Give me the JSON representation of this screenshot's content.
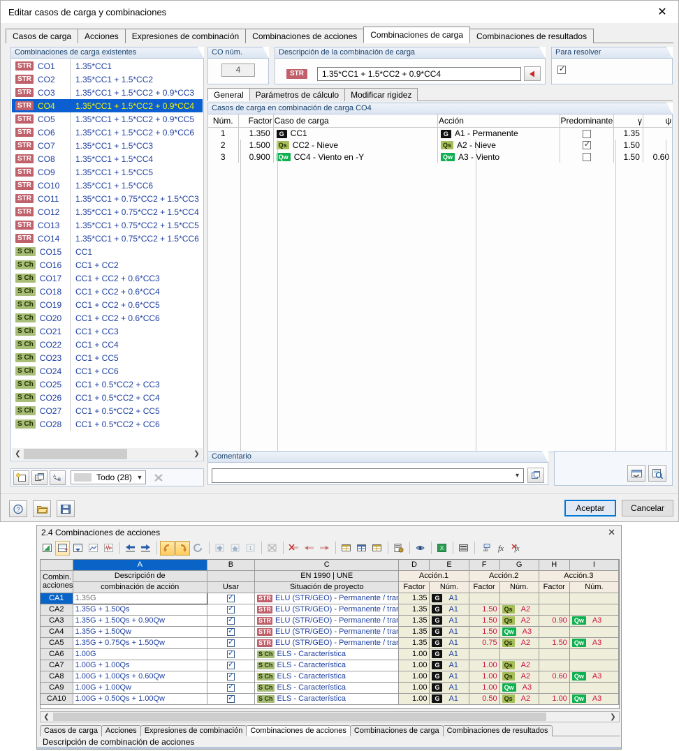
{
  "dialog": {
    "title": "Editar casos de carga y combinaciones",
    "close_icon": "close-icon",
    "tabs": [
      {
        "label": "Casos de carga",
        "active": false
      },
      {
        "label": "Acciones",
        "active": false
      },
      {
        "label": "Expresiones de combinación",
        "active": false
      },
      {
        "label": "Combinaciones de acciones",
        "active": false
      },
      {
        "label": "Combinaciones de carga",
        "active": true
      },
      {
        "label": "Combinaciones de resultados",
        "active": false
      }
    ]
  },
  "list_panel": {
    "header": "Combinaciones de carga existentes",
    "rows": [
      {
        "tag": "STR",
        "num": "CO1",
        "desc": "1.35*CC1",
        "selected": false
      },
      {
        "tag": "STR",
        "num": "CO2",
        "desc": "1.35*CC1 + 1.5*CC2",
        "selected": false
      },
      {
        "tag": "STR",
        "num": "CO3",
        "desc": "1.35*CC1 + 1.5*CC2 + 0.9*CC3",
        "selected": false
      },
      {
        "tag": "STR",
        "num": "CO4",
        "desc": "1.35*CC1 + 1.5*CC2 + 0.9*CC4",
        "selected": true
      },
      {
        "tag": "STR",
        "num": "CO5",
        "desc": "1.35*CC1 + 1.5*CC2 + 0.9*CC5",
        "selected": false
      },
      {
        "tag": "STR",
        "num": "CO6",
        "desc": "1.35*CC1 + 1.5*CC2 + 0.9*CC6",
        "selected": false
      },
      {
        "tag": "STR",
        "num": "CO7",
        "desc": "1.35*CC1 + 1.5*CC3",
        "selected": false
      },
      {
        "tag": "STR",
        "num": "CO8",
        "desc": "1.35*CC1 + 1.5*CC4",
        "selected": false
      },
      {
        "tag": "STR",
        "num": "CO9",
        "desc": "1.35*CC1 + 1.5*CC5",
        "selected": false
      },
      {
        "tag": "STR",
        "num": "CO10",
        "desc": "1.35*CC1 + 1.5*CC6",
        "selected": false
      },
      {
        "tag": "STR",
        "num": "CO11",
        "desc": "1.35*CC1 + 0.75*CC2 + 1.5*CC3",
        "selected": false
      },
      {
        "tag": "STR",
        "num": "CO12",
        "desc": "1.35*CC1 + 0.75*CC2 + 1.5*CC4",
        "selected": false
      },
      {
        "tag": "STR",
        "num": "CO13",
        "desc": "1.35*CC1 + 0.75*CC2 + 1.5*CC5",
        "selected": false
      },
      {
        "tag": "STR",
        "num": "CO14",
        "desc": "1.35*CC1 + 0.75*CC2 + 1.5*CC6",
        "selected": false
      },
      {
        "tag": "S Ch",
        "num": "CO15",
        "desc": "CC1",
        "selected": false
      },
      {
        "tag": "S Ch",
        "num": "CO16",
        "desc": "CC1 + CC2",
        "selected": false
      },
      {
        "tag": "S Ch",
        "num": "CO17",
        "desc": "CC1 + CC2 + 0.6*CC3",
        "selected": false
      },
      {
        "tag": "S Ch",
        "num": "CO18",
        "desc": "CC1 + CC2 + 0.6*CC4",
        "selected": false
      },
      {
        "tag": "S Ch",
        "num": "CO19",
        "desc": "CC1 + CC2 + 0.6*CC5",
        "selected": false
      },
      {
        "tag": "S Ch",
        "num": "CO20",
        "desc": "CC1 + CC2 + 0.6*CC6",
        "selected": false
      },
      {
        "tag": "S Ch",
        "num": "CO21",
        "desc": "CC1 + CC3",
        "selected": false
      },
      {
        "tag": "S Ch",
        "num": "CO22",
        "desc": "CC1 + CC4",
        "selected": false
      },
      {
        "tag": "S Ch",
        "num": "CO23",
        "desc": "CC1 + CC5",
        "selected": false
      },
      {
        "tag": "S Ch",
        "num": "CO24",
        "desc": "CC1 + CC6",
        "selected": false
      },
      {
        "tag": "S Ch",
        "num": "CO25",
        "desc": "CC1 + 0.5*CC2 + CC3",
        "selected": false
      },
      {
        "tag": "S Ch",
        "num": "CO26",
        "desc": "CC1 + 0.5*CC2 + CC4",
        "selected": false
      },
      {
        "tag": "S Ch",
        "num": "CO27",
        "desc": "CC1 + 0.5*CC2 + CC5",
        "selected": false
      },
      {
        "tag": "S Ch",
        "num": "CO28",
        "desc": "CC1 + 0.5*CC2 + CC6",
        "selected": false
      }
    ],
    "tools": {
      "new_icon": "new-combination-icon",
      "copy_icon": "copy-combination-icon",
      "rename_icon": "rename-icon",
      "filter_value": "Todo (28)",
      "delete_icon": "delete-icon"
    }
  },
  "conum": {
    "label": "CO núm.",
    "value": "4"
  },
  "description": {
    "label": "Descripción de la combinación de carga",
    "tag": "STR",
    "value": "1.35*CC1 + 1.5*CC2 + 0.9*CC4",
    "apply_icon": "apply-arrow-icon"
  },
  "solve": {
    "label": "Para resolver",
    "checked": true
  },
  "inner_tabs": [
    {
      "label": "General",
      "active": true
    },
    {
      "label": "Parámetros de cálculo",
      "active": false
    },
    {
      "label": "Modificar rigidez",
      "active": false
    }
  ],
  "cases_table": {
    "header": "Casos de carga en combinación de carga CO4",
    "columns": [
      "Núm.",
      "Factor",
      "Caso de carga",
      "Acción",
      "Predominante",
      "γ",
      "ψ"
    ],
    "rows": [
      {
        "num": "1",
        "factor": "1.350",
        "case_tag": "G",
        "case_label": "CC1",
        "accion_tag": "G",
        "accion_label": "A1 - Permanente",
        "predominante": false,
        "gamma": "1.35",
        "psi": ""
      },
      {
        "num": "2",
        "factor": "1.500",
        "case_tag": "Qs",
        "case_label": "CC2 - Nieve",
        "accion_tag": "Qs",
        "accion_label": "A2 - Nieve",
        "predominante": true,
        "gamma": "1.50",
        "psi": ""
      },
      {
        "num": "3",
        "factor": "0.900",
        "case_tag": "Qw",
        "case_label": "CC4 - Viento en -Y",
        "accion_tag": "Qw",
        "accion_label": "A3 - Viento",
        "predominante": false,
        "gamma": "1.50",
        "psi": "0.60"
      }
    ]
  },
  "comment": {
    "label": "Comentario",
    "value": "",
    "dropdown_icon": "chevron-down-icon",
    "picker_icon": "comment-library-icon"
  },
  "aux_panel": {
    "info_icon": "info-graphic-icon",
    "zoom_icon": "magnifier-icon"
  },
  "footer": {
    "help_icon": "help-icon",
    "open_icon": "open-folder-icon",
    "save_icon": "save-icon",
    "accept_label": "Aceptar",
    "cancel_label": "Cancelar"
  },
  "lower_window": {
    "title": "2.4 Combinaciones de acciones",
    "close_icon": "close-icon",
    "toolbar_icons": [
      "chart-icon",
      "insert-row-icon",
      "import-icon",
      "graph-line-icon",
      "graph-wave-icon",
      "move-left-icon",
      "move-right-icon",
      "undo-icon",
      "redo-icon",
      "refresh-icon",
      "add-icon",
      "star-icon",
      "sort-icon",
      "clear-icon",
      "delete-row-icon",
      "shift-left-icon",
      "shift-right-icon",
      "table-icon",
      "table-blue-icon",
      "edit-table-icon",
      "report-icon",
      "print-icon",
      "excel-icon",
      "calculator-icon",
      "ab-icon",
      "fx-icon",
      "fx-delete-icon"
    ],
    "sheet": {
      "col_letters": [
        "A",
        "B",
        "C",
        "D",
        "E",
        "F",
        "G",
        "H",
        "I"
      ],
      "selected_col": "A",
      "corner_label_1": "Combin.",
      "corner_label_2": "acciones",
      "groups": [
        {
          "label": "Descripción de"
        },
        {
          "label": ""
        },
        {
          "label": "EN 1990 | UNE"
        },
        {
          "label": "Acción.1"
        },
        {
          "label": "Acción.2"
        },
        {
          "label": "Acción.3"
        }
      ],
      "sub": {
        "a": "combinación de acción",
        "b": "Usar",
        "c": "Situación de proyecto",
        "factor": "Factor",
        "num": "Núm."
      },
      "rows": [
        {
          "id": "CA1",
          "selected": true,
          "editing": true,
          "desc": "1.35G",
          "usar": true,
          "sit_tag": "STR",
          "sit": "ELU (STR/GEO) - Permanente / transit",
          "f1": "1.35",
          "t1": "G",
          "n1": "A1",
          "f2": "",
          "t2": "",
          "n2": "",
          "f3": "",
          "t3": "",
          "n3": ""
        },
        {
          "id": "CA2",
          "selected": false,
          "editing": false,
          "desc": "1.35G + 1.50Qs",
          "usar": true,
          "sit_tag": "STR",
          "sit": "ELU (STR/GEO) - Permanente / transit",
          "f1": "1.35",
          "t1": "G",
          "n1": "A1",
          "f2": "1.50",
          "t2": "Qs",
          "n2": "A2",
          "f3": "",
          "t3": "",
          "n3": ""
        },
        {
          "id": "CA3",
          "selected": false,
          "editing": false,
          "desc": "1.35G + 1.50Qs + 0.90Qw",
          "usar": true,
          "sit_tag": "STR",
          "sit": "ELU (STR/GEO) - Permanente / transit",
          "f1": "1.35",
          "t1": "G",
          "n1": "A1",
          "f2": "1.50",
          "t2": "Qs",
          "n2": "A2",
          "f3": "0.90",
          "t3": "Qw",
          "n3": "A3"
        },
        {
          "id": "CA4",
          "selected": false,
          "editing": false,
          "desc": "1.35G + 1.50Qw",
          "usar": true,
          "sit_tag": "STR",
          "sit": "ELU (STR/GEO) - Permanente / transit",
          "f1": "1.35",
          "t1": "G",
          "n1": "A1",
          "f2": "1.50",
          "t2": "Qw",
          "n2": "A3",
          "f3": "",
          "t3": "",
          "n3": ""
        },
        {
          "id": "CA5",
          "selected": false,
          "editing": false,
          "desc": "1.35G + 0.75Qs + 1.50Qw",
          "usar": true,
          "sit_tag": "STR",
          "sit": "ELU (STR/GEO) - Permanente / transit",
          "f1": "1.35",
          "t1": "G",
          "n1": "A1",
          "f2": "0.75",
          "t2": "Qs",
          "n2": "A2",
          "f3": "1.50",
          "t3": "Qw",
          "n3": "A3"
        },
        {
          "id": "CA6",
          "selected": false,
          "editing": false,
          "desc": "1.00G",
          "usar": true,
          "sit_tag": "S Ch",
          "sit": "ELS - Característica",
          "f1": "1.00",
          "t1": "G",
          "n1": "A1",
          "f2": "",
          "t2": "",
          "n2": "",
          "f3": "",
          "t3": "",
          "n3": ""
        },
        {
          "id": "CA7",
          "selected": false,
          "editing": false,
          "desc": "1.00G + 1.00Qs",
          "usar": true,
          "sit_tag": "S Ch",
          "sit": "ELS - Característica",
          "f1": "1.00",
          "t1": "G",
          "n1": "A1",
          "f2": "1.00",
          "t2": "Qs",
          "n2": "A2",
          "f3": "",
          "t3": "",
          "n3": ""
        },
        {
          "id": "CA8",
          "selected": false,
          "editing": false,
          "desc": "1.00G + 1.00Qs + 0.60Qw",
          "usar": true,
          "sit_tag": "S Ch",
          "sit": "ELS - Característica",
          "f1": "1.00",
          "t1": "G",
          "n1": "A1",
          "f2": "1.00",
          "t2": "Qs",
          "n2": "A2",
          "f3": "0.60",
          "t3": "Qw",
          "n3": "A3"
        },
        {
          "id": "CA9",
          "selected": false,
          "editing": false,
          "desc": "1.00G + 1.00Qw",
          "usar": true,
          "sit_tag": "S Ch",
          "sit": "ELS - Característica",
          "f1": "1.00",
          "t1": "G",
          "n1": "A1",
          "f2": "1.00",
          "t2": "Qw",
          "n2": "A3",
          "f3": "",
          "t3": "",
          "n3": ""
        },
        {
          "id": "CA10",
          "selected": false,
          "editing": false,
          "desc": "1.00G + 0.50Qs + 1.00Qw",
          "usar": true,
          "sit_tag": "S Ch",
          "sit": "ELS - Característica",
          "f1": "1.00",
          "t1": "G",
          "n1": "A1",
          "f2": "0.50",
          "t2": "Qs",
          "n2": "A2",
          "f3": "1.00",
          "t3": "Qw",
          "n3": "A3"
        }
      ]
    },
    "tabs": [
      {
        "label": "Casos de carga",
        "active": false
      },
      {
        "label": "Acciones",
        "active": false
      },
      {
        "label": "Expresiones de combinación",
        "active": false
      },
      {
        "label": "Combinaciones de acciones",
        "active": true
      },
      {
        "label": "Combinaciones de carga",
        "active": false
      },
      {
        "label": "Combinaciones de resultados",
        "active": false
      }
    ],
    "status": "Descripción de combinación de acciones"
  }
}
